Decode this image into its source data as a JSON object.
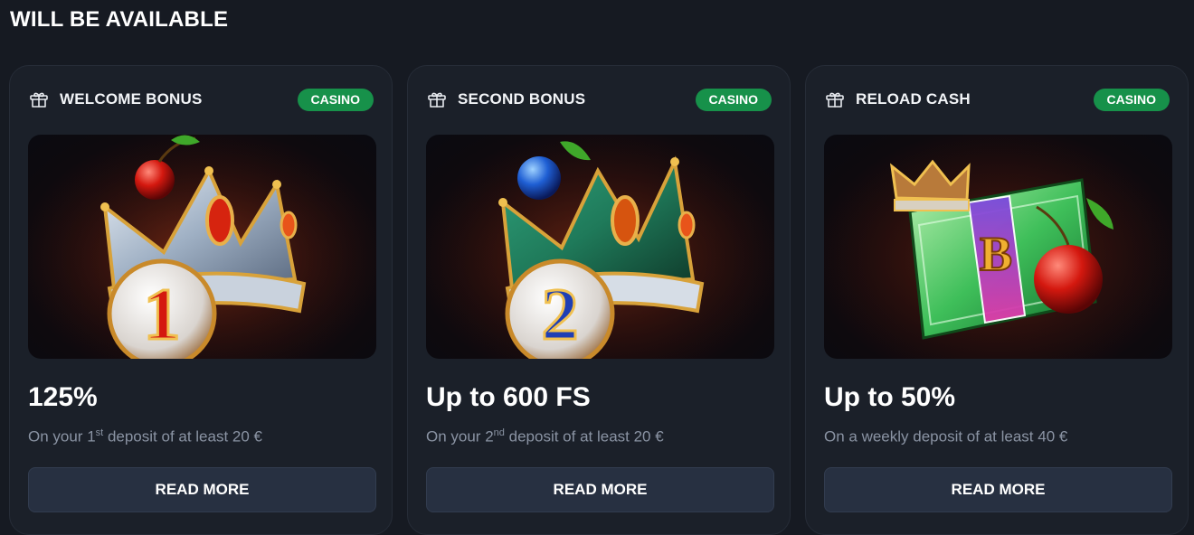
{
  "page": {
    "title": "WILL BE AVAILABLE"
  },
  "colors": {
    "badge_green": "#17914a",
    "button_bg": "#273041",
    "card_bg": "#1b2029",
    "muted_text": "#8a93a3"
  },
  "cards": [
    {
      "icon": "gift-icon",
      "name": "WELCOME BONUS",
      "badge": "CASINO",
      "image": "crown-with-cherry-and-number-1",
      "amount": "125%",
      "desc_before": "On your 1",
      "desc_sup": "st",
      "desc_after": " deposit of at least 20 €",
      "button": "READ MORE"
    },
    {
      "icon": "gift-icon",
      "name": "SECOND BONUS",
      "badge": "CASINO",
      "image": "crown-with-plum-and-number-2",
      "amount": "Up to 600 FS",
      "desc_before": "On your 2",
      "desc_sup": "nd",
      "desc_after": " deposit of at least 20 €",
      "button": "READ MORE"
    },
    {
      "icon": "gift-icon",
      "name": "RELOAD CASH",
      "badge": "CASINO",
      "image": "money-stack-with-crown-and-cherry",
      "amount": "Up to 50%",
      "desc_before": "On a weekly deposit of at least 40 €",
      "desc_sup": "",
      "desc_after": "",
      "button": "READ MORE"
    }
  ]
}
